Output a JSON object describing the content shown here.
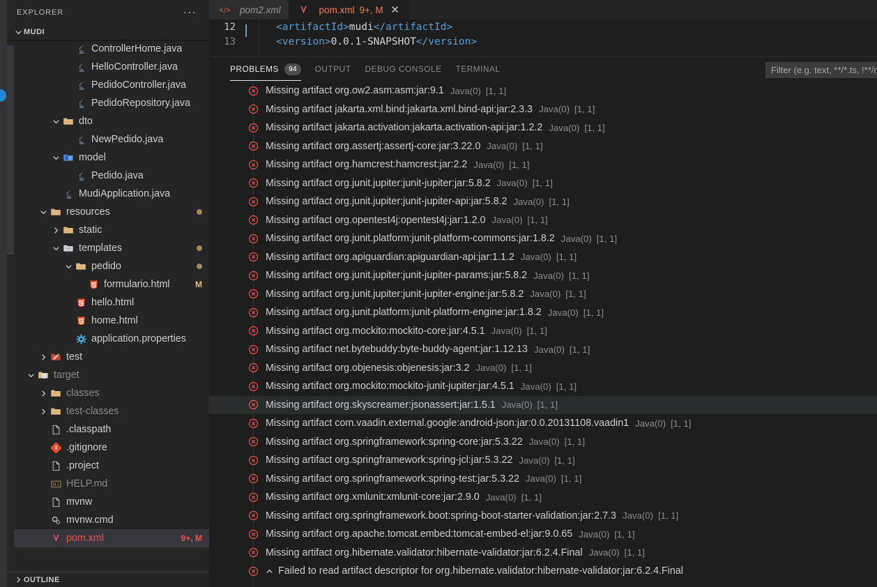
{
  "activity_bar": {
    "badge_color": "#1f8ad2"
  },
  "sidebar": {
    "title": "EXPLORER",
    "more_actions": "···",
    "project": {
      "name": "MUDI"
    },
    "outline": {
      "label": "OUTLINE"
    },
    "tree": [
      {
        "label": "ControllerHome.java",
        "icon": "java-icon",
        "indent": 4,
        "twisty": "none",
        "badge": ""
      },
      {
        "label": "HelloController.java",
        "icon": "java-icon",
        "indent": 4,
        "twisty": "none",
        "badge": ""
      },
      {
        "label": "PedidoController.java",
        "icon": "java-icon",
        "indent": 4,
        "twisty": "none",
        "badge": ""
      },
      {
        "label": "PedidoRepository.java",
        "icon": "java-icon",
        "indent": 4,
        "twisty": "none",
        "badge": ""
      },
      {
        "label": "dto",
        "icon": "folder-icon",
        "indent": 3,
        "twisty": "expanded",
        "badge": ""
      },
      {
        "label": "NewPedido.java",
        "icon": "java-icon",
        "indent": 4,
        "twisty": "none",
        "badge": ""
      },
      {
        "label": "model",
        "icon": "folder-db-icon",
        "indent": 3,
        "twisty": "expanded",
        "badge": ""
      },
      {
        "label": "Pedido.java",
        "icon": "java-icon",
        "indent": 4,
        "twisty": "none",
        "badge": ""
      },
      {
        "label": "MudiApplication.java",
        "icon": "java-icon",
        "indent": 3,
        "twisty": "none",
        "badge": ""
      },
      {
        "label": "resources",
        "icon": "folder-icon",
        "indent": 2,
        "twisty": "expanded",
        "badge": "dot"
      },
      {
        "label": "static",
        "icon": "folder-icon",
        "indent": 3,
        "twisty": "collapsed",
        "badge": ""
      },
      {
        "label": "templates",
        "icon": "folder-tpl-icon",
        "indent": 3,
        "twisty": "expanded",
        "badge": "dot"
      },
      {
        "label": "pedido",
        "icon": "folder-icon",
        "indent": 4,
        "twisty": "expanded",
        "badge": "dot"
      },
      {
        "label": "formulario.html",
        "icon": "html5-icon",
        "indent": 5,
        "twisty": "none",
        "badge": "M",
        "modified": true
      },
      {
        "label": "hello.html",
        "icon": "html5-icon",
        "indent": 4,
        "twisty": "none",
        "badge": ""
      },
      {
        "label": "home.html",
        "icon": "html5-icon",
        "indent": 4,
        "twisty": "none",
        "badge": ""
      },
      {
        "label": "application.properties",
        "icon": "gear-icon",
        "indent": 4,
        "twisty": "none",
        "badge": ""
      },
      {
        "label": "test",
        "icon": "folder-test-icon",
        "indent": 2,
        "twisty": "collapsed",
        "badge": ""
      },
      {
        "label": "target",
        "icon": "folder-target-icon",
        "indent": 1,
        "twisty": "expanded",
        "badge": "",
        "dim": true
      },
      {
        "label": "classes",
        "icon": "folder-icon",
        "indent": 2,
        "twisty": "collapsed",
        "badge": "",
        "dim": true
      },
      {
        "label": "test-classes",
        "icon": "folder-icon",
        "indent": 2,
        "twisty": "collapsed",
        "badge": "",
        "dim": true
      },
      {
        "label": ".classpath",
        "icon": "file-icon",
        "indent": 2,
        "twisty": "none",
        "badge": ""
      },
      {
        "label": ".gitignore",
        "icon": "git-icon",
        "indent": 2,
        "twisty": "none",
        "badge": ""
      },
      {
        "label": ".project",
        "icon": "file-icon",
        "indent": 2,
        "twisty": "none",
        "badge": ""
      },
      {
        "label": "HELP.md",
        "icon": "markdown-icon",
        "indent": 2,
        "twisty": "none",
        "badge": "",
        "dim": true
      },
      {
        "label": "mvnw",
        "icon": "file-icon",
        "indent": 2,
        "twisty": "none",
        "badge": ""
      },
      {
        "label": "mvnw.cmd",
        "icon": "gears-icon",
        "indent": 2,
        "twisty": "none",
        "badge": ""
      },
      {
        "label": "pom.xml",
        "icon": "maven-icon",
        "indent": 2,
        "twisty": "none",
        "badge": "9+, M",
        "selected": true,
        "error": true
      }
    ]
  },
  "tabs": [
    {
      "label": "pom2.xml",
      "icon": "code-xml-icon",
      "active": false,
      "badge": "",
      "closable": false
    },
    {
      "label": "pom.xml",
      "icon": "maven-icon",
      "active": true,
      "badge": "9+, M",
      "closable": true
    }
  ],
  "editor": {
    "lines": [
      {
        "number": "12",
        "current": true,
        "segments": [
          {
            "t": "<artifactId>",
            "c": "tag"
          },
          {
            "t": "mudi",
            "c": "val"
          },
          {
            "t": "</artifactId>",
            "c": "tag"
          }
        ]
      },
      {
        "number": "13",
        "current": false,
        "segments": [
          {
            "t": "<version>",
            "c": "tag"
          },
          {
            "t": "0.0.1-SNAPSHOT",
            "c": "val"
          },
          {
            "t": "</version>",
            "c": "tag"
          }
        ]
      }
    ]
  },
  "panel": {
    "tabs": [
      {
        "label": "PROBLEMS",
        "active": true,
        "count": "94"
      },
      {
        "label": "OUTPUT",
        "active": false,
        "count": ""
      },
      {
        "label": "DEBUG CONSOLE",
        "active": false,
        "count": ""
      },
      {
        "label": "TERMINAL",
        "active": false,
        "count": ""
      }
    ],
    "filter_placeholder": "Filter (e.g. text, **/*.ts, !**/node_modules/**)",
    "filter_value": "",
    "problems": [
      {
        "message": "Missing artifact org.ow2.asm:asm:jar:9.1",
        "source": "Java(0)",
        "position": "[1, 1]",
        "severity": "error"
      },
      {
        "message": "Missing artifact jakarta.xml.bind:jakarta.xml.bind-api:jar:2.3.3",
        "source": "Java(0)",
        "position": "[1, 1]",
        "severity": "error"
      },
      {
        "message": "Missing artifact jakarta.activation:jakarta.activation-api:jar:1.2.2",
        "source": "Java(0)",
        "position": "[1, 1]",
        "severity": "error"
      },
      {
        "message": "Missing artifact org.assertj:assertj-core:jar:3.22.0",
        "source": "Java(0)",
        "position": "[1, 1]",
        "severity": "error"
      },
      {
        "message": "Missing artifact org.hamcrest:hamcrest:jar:2.2",
        "source": "Java(0)",
        "position": "[1, 1]",
        "severity": "error"
      },
      {
        "message": "Missing artifact org.junit.jupiter:junit-jupiter:jar:5.8.2",
        "source": "Java(0)",
        "position": "[1, 1]",
        "severity": "error"
      },
      {
        "message": "Missing artifact org.junit.jupiter:junit-jupiter-api:jar:5.8.2",
        "source": "Java(0)",
        "position": "[1, 1]",
        "severity": "error"
      },
      {
        "message": "Missing artifact org.opentest4j:opentest4j:jar:1.2.0",
        "source": "Java(0)",
        "position": "[1, 1]",
        "severity": "error"
      },
      {
        "message": "Missing artifact org.junit.platform:junit-platform-commons:jar:1.8.2",
        "source": "Java(0)",
        "position": "[1, 1]",
        "severity": "error"
      },
      {
        "message": "Missing artifact org.apiguardian:apiguardian-api:jar:1.1.2",
        "source": "Java(0)",
        "position": "[1, 1]",
        "severity": "error"
      },
      {
        "message": "Missing artifact org.junit.jupiter:junit-jupiter-params:jar:5.8.2",
        "source": "Java(0)",
        "position": "[1, 1]",
        "severity": "error"
      },
      {
        "message": "Missing artifact org.junit.jupiter:junit-jupiter-engine:jar:5.8.2",
        "source": "Java(0)",
        "position": "[1, 1]",
        "severity": "error"
      },
      {
        "message": "Missing artifact org.junit.platform:junit-platform-engine:jar:1.8.2",
        "source": "Java(0)",
        "position": "[1, 1]",
        "severity": "error"
      },
      {
        "message": "Missing artifact org.mockito:mockito-core:jar:4.5.1",
        "source": "Java(0)",
        "position": "[1, 1]",
        "severity": "error"
      },
      {
        "message": "Missing artifact net.bytebuddy:byte-buddy-agent:jar:1.12.13",
        "source": "Java(0)",
        "position": "[1, 1]",
        "severity": "error"
      },
      {
        "message": "Missing artifact org.objenesis:objenesis:jar:3.2",
        "source": "Java(0)",
        "position": "[1, 1]",
        "severity": "error"
      },
      {
        "message": "Missing artifact org.mockito:mockito-junit-jupiter:jar:4.5.1",
        "source": "Java(0)",
        "position": "[1, 1]",
        "severity": "error"
      },
      {
        "message": "Missing artifact org.skyscreamer:jsonassert:jar:1.5.1",
        "source": "Java(0)",
        "position": "[1, 1]",
        "severity": "error",
        "highlight": true
      },
      {
        "message": "Missing artifact com.vaadin.external.google:android-json:jar:0.0.20131108.vaadin1",
        "source": "Java(0)",
        "position": "[1, 1]",
        "severity": "error"
      },
      {
        "message": "Missing artifact org.springframework:spring-core:jar:5.3.22",
        "source": "Java(0)",
        "position": "[1, 1]",
        "severity": "error"
      },
      {
        "message": "Missing artifact org.springframework:spring-jcl:jar:5.3.22",
        "source": "Java(0)",
        "position": "[1, 1]",
        "severity": "error"
      },
      {
        "message": "Missing artifact org.springframework:spring-test:jar:5.3.22",
        "source": "Java(0)",
        "position": "[1, 1]",
        "severity": "error"
      },
      {
        "message": "Missing artifact org.xmlunit:xmlunit-core:jar:2.9.0",
        "source": "Java(0)",
        "position": "[1, 1]",
        "severity": "error"
      },
      {
        "message": "Missing artifact org.springframework.boot:spring-boot-starter-validation:jar:2.7.3",
        "source": "Java(0)",
        "position": "[1, 1]",
        "severity": "error"
      },
      {
        "message": "Missing artifact org.apache.tomcat.embed:tomcat-embed-el:jar:9.0.65",
        "source": "Java(0)",
        "position": "[1, 1]",
        "severity": "error"
      },
      {
        "message": "Missing artifact org.hibernate.validator:hibernate-validator:jar:6.2.4.Final",
        "source": "Java(0)",
        "position": "[1, 1]",
        "severity": "error"
      },
      {
        "message": "Failed to read artifact descriptor for org.hibernate.validator:hibernate-validator:jar:6.2.4.Final",
        "source": "",
        "position": "",
        "severity": "error",
        "expandable": true
      }
    ]
  }
}
